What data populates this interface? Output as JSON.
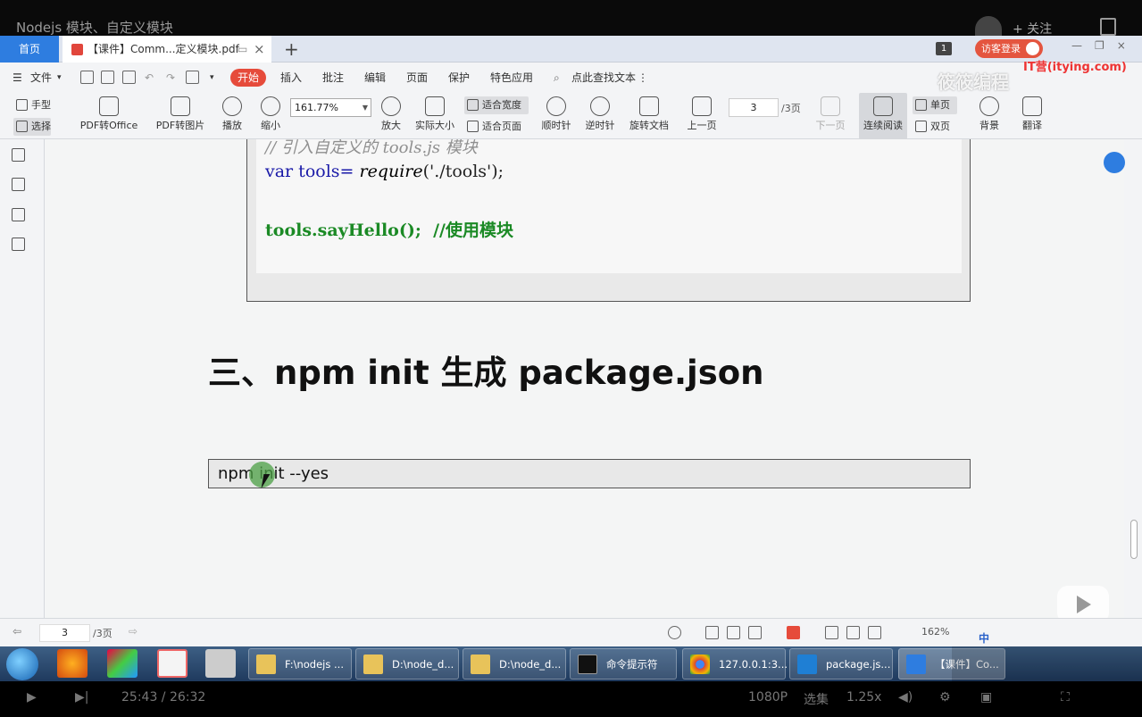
{
  "video": {
    "title": "Nodejs 模块、自定义模块",
    "follow": "+ 关注",
    "time": "25:43 / 26:32",
    "quality": "1080P",
    "select": "选集",
    "speed": "1.25x"
  },
  "tabs": {
    "home": "首页",
    "doc": "【课件】Comm...定义模块.pdf",
    "close": "×",
    "plus": "+",
    "page_badge": "1",
    "login": "访客登录"
  },
  "watermark": {
    "brand": "筱筱编程",
    "site": "IT营(itying.com)"
  },
  "menu": {
    "file": "文件",
    "start": "开始",
    "items": [
      "插入",
      "批注",
      "编辑",
      "页面",
      "保护",
      "特色应用"
    ],
    "search": "点此查找文本",
    "more": "⋮"
  },
  "toolbar": {
    "hand": "手型",
    "select": "选择",
    "pdf_office": "PDF转Office",
    "pdf_image": "PDF转图片",
    "play": "播放",
    "zoom_out": "缩小",
    "zoom_value": "161.77%",
    "zoom_in": "放大",
    "actual": "实际大小",
    "fit_width": "适合宽度",
    "fit_page": "适合页面",
    "cw": "顺时针",
    "ccw": "逆时针",
    "rotate": "旋转文档",
    "prev": "上一页",
    "page": "3",
    "total": "/3页",
    "next": "下一页",
    "continuous": "连续阅读",
    "single": "单页",
    "double": "双页",
    "background": "背景",
    "translate": "翻译"
  },
  "document": {
    "code_comment": "// 引入自定义的 tools.js 模块",
    "code_var": "var tools= ",
    "code_require": "require",
    "code_arg": "('./tools');",
    "code_call": "tools.sayHello();  //使用模块",
    "heading": "三、npm init  生成 package.json",
    "command": "npm init --yes"
  },
  "status": {
    "page": "3",
    "total": "/3页",
    "zoom": "162%"
  },
  "taskbar": {
    "items": [
      "F:\\nodejs ...",
      "D:\\node_d...",
      "D:\\node_d...",
      "命令提示符",
      "127.0.0.1:3...",
      "package.js...",
      "【课件】Co..."
    ]
  },
  "tray": {
    "ime": "中"
  },
  "colors": {
    "accent_blue": "#2e7de0",
    "accent_red": "#e64b3b",
    "code_keyword": "#1a1aa8",
    "code_green": "#1b8a25"
  }
}
